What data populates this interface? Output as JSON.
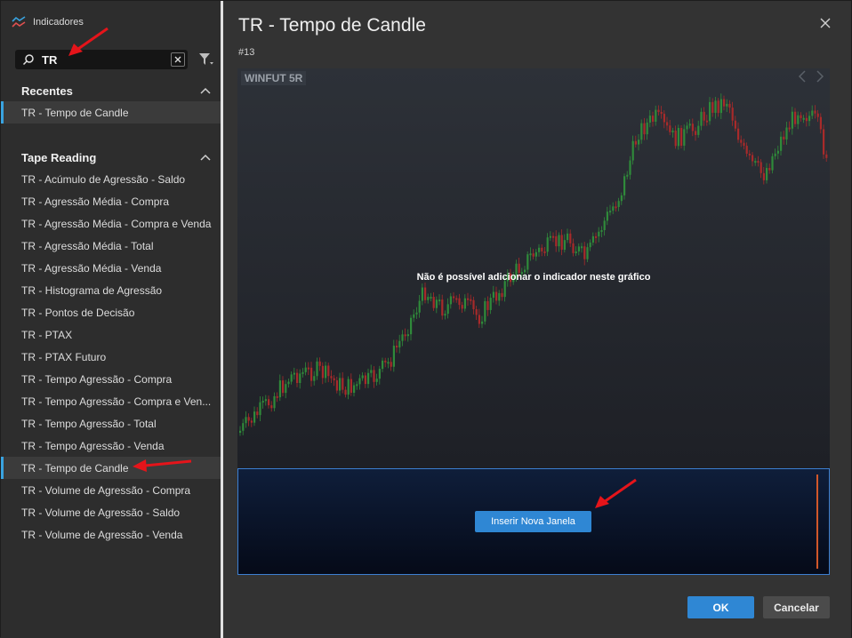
{
  "sidebar": {
    "title": "Indicadores",
    "search": {
      "value": "TR"
    },
    "recent": {
      "title": "Recentes",
      "items": [
        "TR - Tempo de Candle"
      ]
    },
    "tape": {
      "title": "Tape Reading",
      "items": [
        "TR - Acúmulo de Agressão - Saldo",
        "TR - Agressão Média - Compra",
        "TR - Agressão Média - Compra e Venda",
        "TR - Agressão Média - Total",
        "TR - Agressão Média - Venda",
        "TR - Histograma de Agressão",
        "TR - Pontos de Decisão",
        "TR - PTAX",
        "TR - PTAX Futuro",
        "TR - Tempo Agressão - Compra",
        "TR - Tempo Agressão - Compra e Ven...",
        "TR - Tempo Agressão - Total",
        "TR - Tempo Agressão - Venda",
        "TR - Tempo de Candle",
        "TR - Volume de Agressão - Compra",
        "TR - Volume de Agressão - Saldo",
        "TR - Volume de Agressão - Venda"
      ]
    }
  },
  "main": {
    "title": "TR - Tempo de Candle",
    "subtitle": "#13",
    "chart": {
      "symbol": "WINFUT 5R",
      "message": "Não é possível adicionar o indicador neste gráfico"
    },
    "insert_button": "Inserir Nova Janela",
    "ok": "OK",
    "cancel": "Cancelar"
  },
  "colors": {
    "accent": "#2f87d4",
    "candle_up": "#2f8a3a",
    "candle_down": "#a82a2a",
    "annotation_arrow": "#e5141a"
  }
}
